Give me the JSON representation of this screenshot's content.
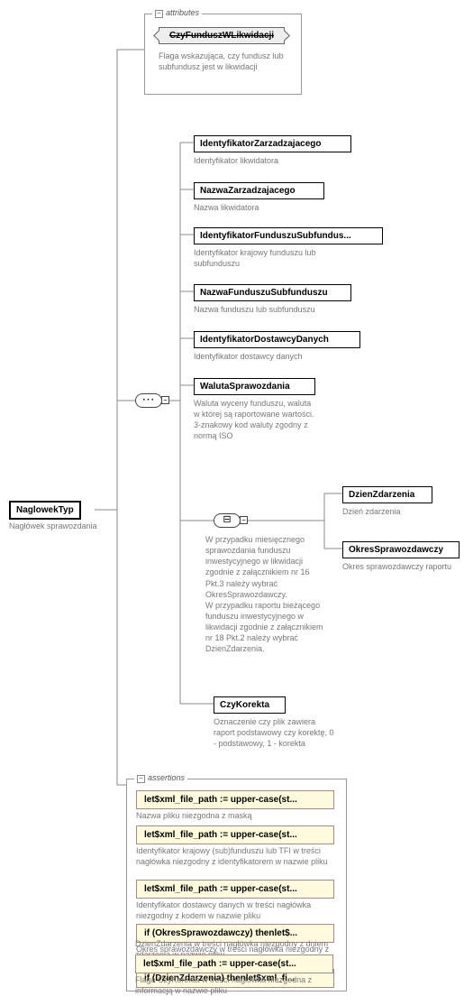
{
  "root": {
    "name": "NaglowekTyp",
    "desc": "Nagłówek sprawozdania"
  },
  "sections": {
    "attributes": "attributes",
    "assertions": "assertions"
  },
  "attribute": {
    "name": "CzyFunduszWLikwidacji",
    "desc": "Flaga wskazująca, czy fundusz lub subfundusz jest w likwidacji"
  },
  "elements": [
    {
      "name": "IdentyfikatorZarzadzajacego",
      "desc": "Identyfikator likwidatora"
    },
    {
      "name": "NazwaZarzadzajacego",
      "desc": "Nazwa likwidatora"
    },
    {
      "name": "IdentyfikatorFunduszuSubfundus...",
      "desc": "Identyfikator krajowy funduszu lub subfunduszu"
    },
    {
      "name": "NazwaFunduszuSubfunduszu",
      "desc": "Nazwa funduszu lub subfunduszu"
    },
    {
      "name": "IdentyfikatorDostawcyDanych",
      "desc": "Identyfikator dostawcy danych"
    },
    {
      "name": "WalutaSprawozdania",
      "desc": "Waluta wyceny funduszu, waluta w której są raportowane wartości. 3-znakowy kod waluty zgodny z normą ISO"
    }
  ],
  "choice_desc": "W przypadku miesięcznego sprawozdania funduszu inwestycyjnego w likwidacji zgodnie z załącznikiem nr 16 Pkt.3 należy wybrać OkresSprawozdawczy.\nW przypadku raportu bieżącego funduszu inwestycyjnego w likwidacji zgodnie z załącznikiem nr 18 Pkt.2 należy wybrać DzienZdarzenia.",
  "choice_items": [
    {
      "name": "DzienZdarzenia",
      "desc": "Dzień zdarzenia"
    },
    {
      "name": "OkresSprawozdawczy",
      "desc": "Okres sprawozdawczy raportu"
    }
  ],
  "last_element": {
    "name": "CzyKorekta",
    "desc": "Oznaczenie czy plik zawiera raport podstawowy czy korektę, 0 - podstawowy, 1 - korekta"
  },
  "assertions": [
    {
      "expr": "let$xml_file_path := upper-case(st...",
      "desc": "Nazwa pliku niezgodna z maską"
    },
    {
      "expr": "let$xml_file_path := upper-case(st...",
      "desc": "Identyfikator krajowy (sub)funduszu lub TFI w treści nagłówka niezgodny z identyfikatorem w nazwie pliku"
    },
    {
      "expr": "let$xml_file_path := upper-case(st...",
      "desc": "Identyfikator dostawcy danych w treści nagłówka niezgodny z kodem w nazwie pliku"
    },
    {
      "expr": "if (OkresSprawozdawczy) thenlet$...",
      "desc": "Okres sprawozdawczy w treści nagłówka niezgodny z okresem w nazwie pliku"
    },
    {
      "expr": "if (DzienZdarzenia) thenlet$xml_fi...",
      "desc": "DzienZdarzenia w treści nagłówka niezgodny z dniem zdarzenia w nazwie pliku"
    },
    {
      "expr": "let$xml_file_path := upper-case(st...",
      "desc": "Flaga CzyKorekta w treści nagłówka niezgodna z informacją w nazwie pliku"
    }
  ]
}
